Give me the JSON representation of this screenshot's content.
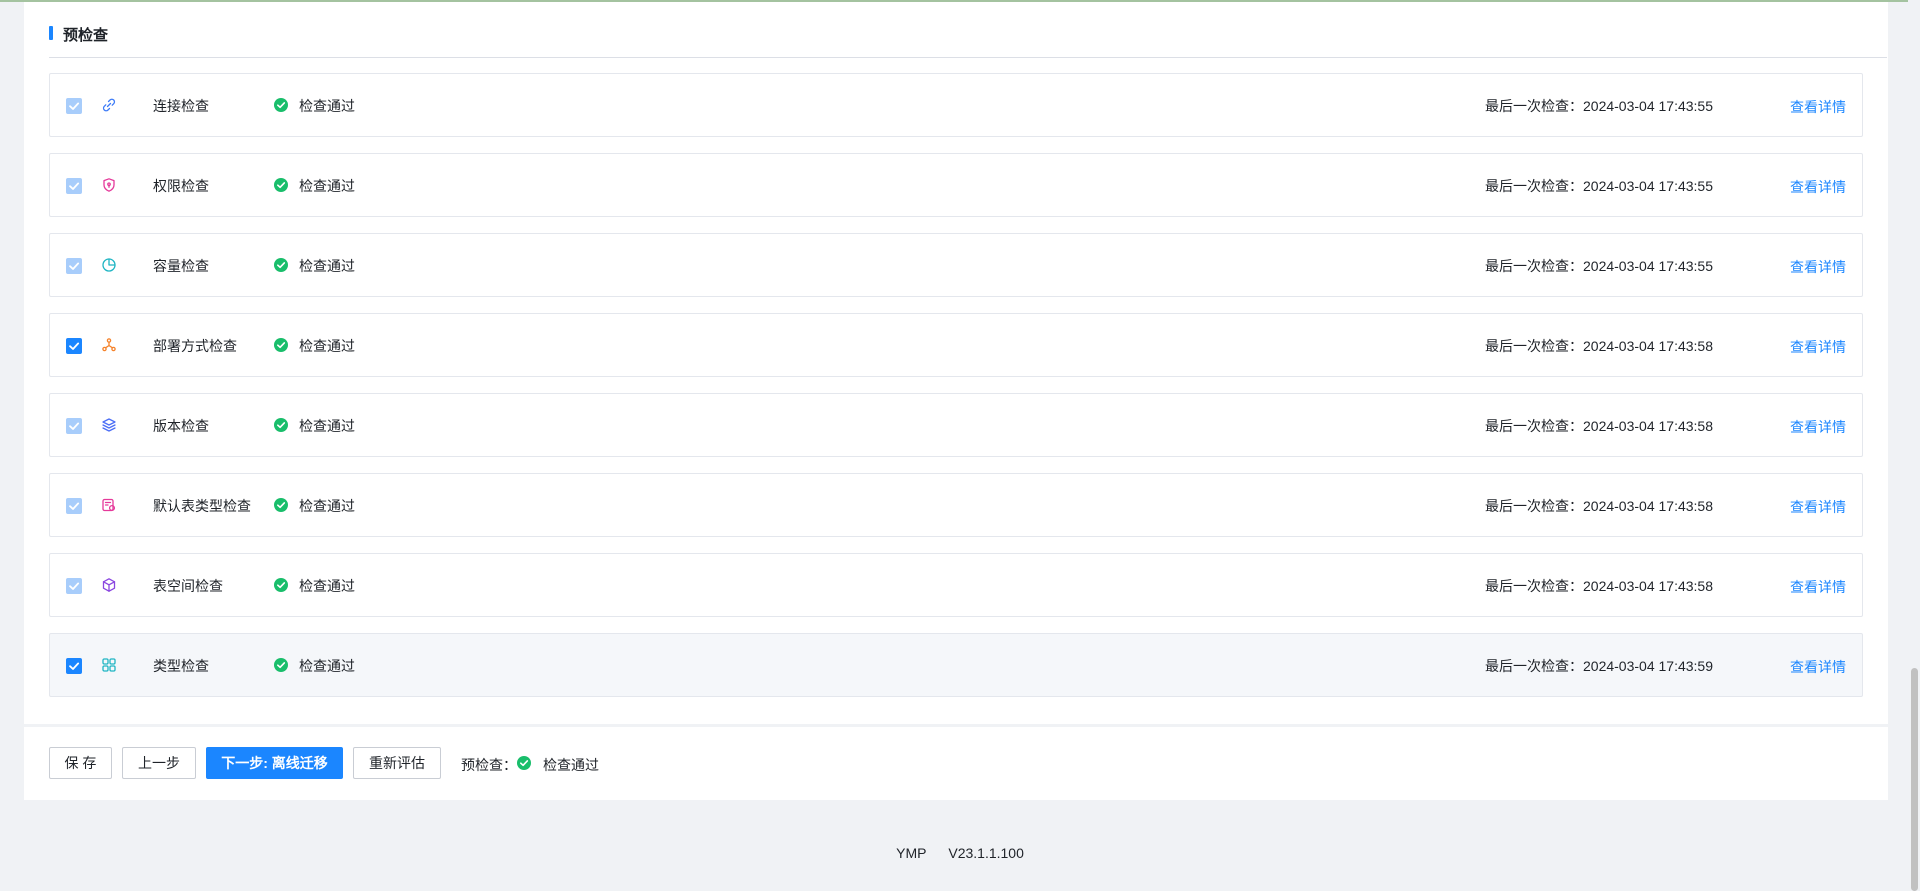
{
  "section": {
    "title": "预检查"
  },
  "checks": [
    {
      "name": "连接检查",
      "icon": "link-icon",
      "icon_color": "#3d7bf7",
      "checked_disabled": true,
      "status": "检查通过",
      "last_check_label": "最后一次检查：",
      "last_check_time": "2024-03-04 17:43:55",
      "detail": "查看详情"
    },
    {
      "name": "权限检查",
      "icon": "shield-icon",
      "icon_color": "#e5399a",
      "checked_disabled": true,
      "status": "检查通过",
      "last_check_label": "最后一次检查：",
      "last_check_time": "2024-03-04 17:43:55",
      "detail": "查看详情"
    },
    {
      "name": "容量检查",
      "icon": "pie-chart-icon",
      "icon_color": "#1fb5c3",
      "checked_disabled": true,
      "status": "检查通过",
      "last_check_label": "最后一次检查：",
      "last_check_time": "2024-03-04 17:43:55",
      "detail": "查看详情"
    },
    {
      "name": "部署方式检查",
      "icon": "deployment-icon",
      "icon_color": "#f5822a",
      "checked_disabled": false,
      "status": "检查通过",
      "last_check_label": "最后一次检查：",
      "last_check_time": "2024-03-04 17:43:58",
      "detail": "查看详情"
    },
    {
      "name": "版本检查",
      "icon": "layers-icon",
      "icon_color": "#4c6ef5",
      "checked_disabled": true,
      "status": "检查通过",
      "last_check_label": "最后一次检查：",
      "last_check_time": "2024-03-04 17:43:58",
      "detail": "查看详情"
    },
    {
      "name": "默认表类型检查",
      "icon": "table-type-icon",
      "icon_color": "#e5399a",
      "checked_disabled": true,
      "status": "检查通过",
      "last_check_label": "最后一次检查：",
      "last_check_time": "2024-03-04 17:43:58",
      "detail": "查看详情"
    },
    {
      "name": "表空间检查",
      "icon": "cube-icon",
      "icon_color": "#8a46e0",
      "checked_disabled": true,
      "status": "检查通过",
      "last_check_label": "最后一次检查：",
      "last_check_time": "2024-03-04 17:43:58",
      "detail": "查看详情"
    },
    {
      "name": "类型检查",
      "icon": "grid-icon",
      "icon_color": "#1fb5c3",
      "checked_disabled": false,
      "status": "检查通过",
      "last_check_label": "最后一次检查：",
      "last_check_time": "2024-03-04 17:43:59",
      "detail": "查看详情"
    }
  ],
  "actions": {
    "save": "保 存",
    "prev": "上一步",
    "next": "下一步: 离线迁移",
    "reassess": "重新评估",
    "precheck_label": "预检查：",
    "precheck_status": "检查通过"
  },
  "footer": {
    "product": "YMP",
    "version": "V23.1.1.100"
  },
  "colors": {
    "primary": "#1b86ff",
    "success": "#19be6b",
    "checkbox_disabled": "#a8cdfb"
  }
}
